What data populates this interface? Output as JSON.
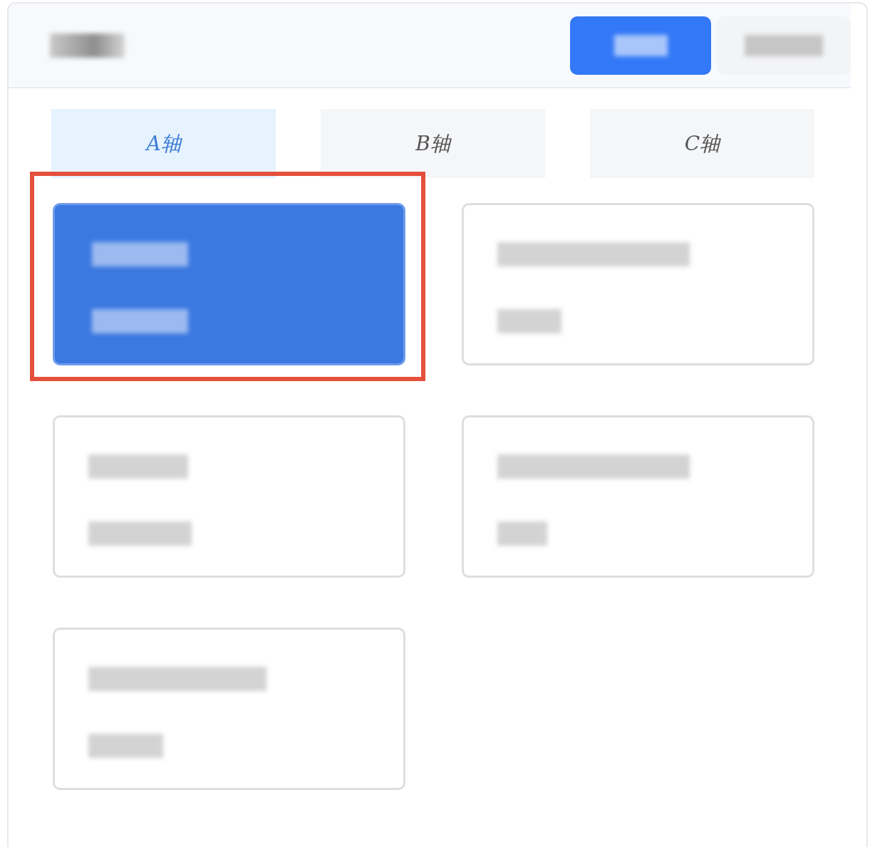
{
  "header": {
    "buttons": [
      {
        "selected": true
      },
      {
        "selected": false
      }
    ]
  },
  "tabs": [
    {
      "label": "A轴",
      "selected": true
    },
    {
      "label": "B轴",
      "selected": false
    },
    {
      "label": "C轴",
      "selected": false
    }
  ],
  "cards": [
    {
      "selected": true,
      "highlighted": true
    },
    {
      "selected": false,
      "highlighted": false
    },
    {
      "selected": false,
      "highlighted": false
    },
    {
      "selected": false,
      "highlighted": false
    },
    {
      "selected": false,
      "highlighted": false
    }
  ]
}
